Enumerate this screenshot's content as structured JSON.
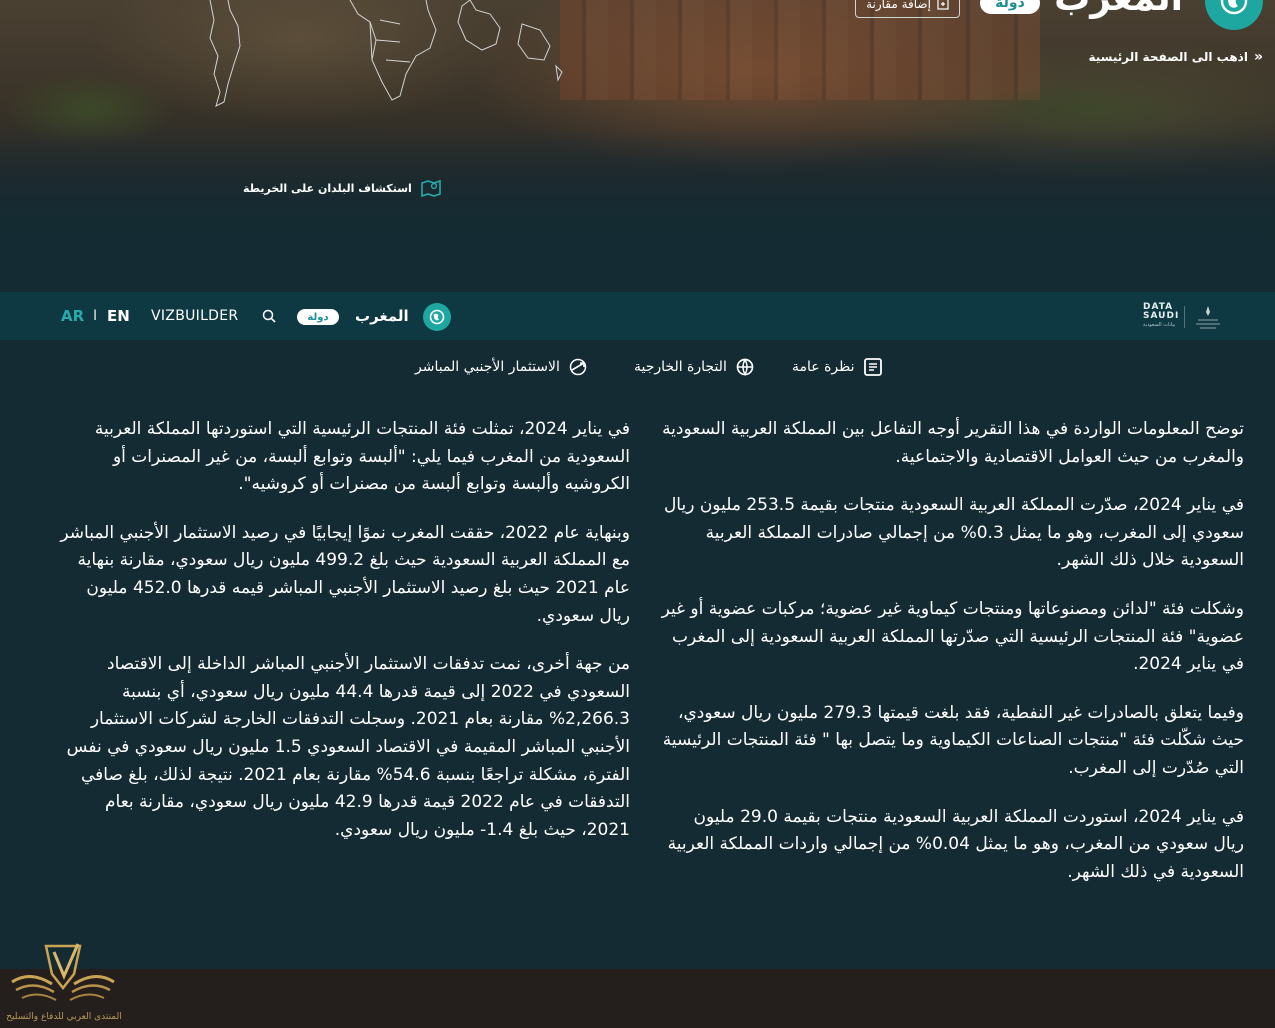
{
  "hero": {
    "country_title": "المغرب",
    "type_badge": "دولة",
    "add_compare_label": "إضافة مقارنة",
    "go_home_label": "اذهب الى الصفحة الرئيسية",
    "explore_map_label": "استكشاف البلدان على الخريطة"
  },
  "navbar": {
    "country_name": "المغرب",
    "type_badge": "دولة",
    "vizbuilder_label": "VIZBUILDER",
    "lang_en": "EN",
    "lang_separator": "I",
    "lang_ar": "AR",
    "logo_main": "DATA SAUDI",
    "logo_sub": "بيانات السعودية"
  },
  "tabs": [
    {
      "label": "نظرة عامة",
      "icon": "document-icon"
    },
    {
      "label": "التجارة الخارجية",
      "icon": "trade-globe-icon"
    },
    {
      "label": "الاستثمار الأجنبي المباشر",
      "icon": "investment-icon"
    }
  ],
  "content": {
    "right_column": [
      "توضح المعلومات الواردة في هذا التقرير أوجه التفاعل بين المملكة العربية السعودية والمغرب من حيث العوامل الاقتصادية والاجتماعية.",
      "في يناير 2024، صدّرت المملكة العربية السعودية منتجات بقيمة 253.5 مليون ريال سعودي إلى المغرب، وهو ما يمثل 0.3% من إجمالي صادرات المملكة العربية السعودية خلال ذلك الشهر.",
      "وشكلت فئة \"لدائن ومصنوعاتها ومنتجات كيماوية غير عضوية؛ مركبات عضوية أو غير عضوية\" فئة المنتجات الرئيسية التي صدّرتها المملكة العربية السعودية إلى المغرب في يناير 2024.",
      "وفيما يتعلق بالصادرات غير النفطية، فقد بلغت قيمتها 279.3 مليون ريال سعودي، حيث شكّلت فئة \"منتجات الصناعات الكيماوية وما يتصل بها \" فئة المنتجات الرئيسية التي صُدّرت إلى المغرب.",
      "في يناير 2024، استوردت المملكة العربية السعودية منتجات بقيمة 29.0 مليون ريال سعودي من المغرب، وهو ما يمثل 0.04% من إجمالي واردات المملكة العربية السعودية في ذلك الشهر."
    ],
    "left_column": [
      "في يناير 2024، تمثلت فئة المنتجات الرئيسية التي استوردتها المملكة العربية السعودية من المغرب فيما يلي: \"ألبسة وتوابع ألبسة، من غير المصنرات أو الكروشيه وألبسة وتوابع ألبسة من مصنرات أو كروشيه\".",
      "وبنهاية عام 2022، حققت المغرب نموًا إيجابيًا في رصيد الاستثمار الأجنبي المباشر مع المملكة العربية السعودية حيث بلغ 499.2 مليون ريال سعودي، مقارنة بنهاية عام 2021 حيث بلغ رصيد الاستثمار الأجنبي المباشر قيمه قدرها 452.0 مليون ريال سعودي.",
      "من جهة أخرى، نمت تدفقات الاستثمار الأجنبي المباشر الداخلة إلى الاقتصاد السعودي في 2022 إلى قيمة قدرها 44.4 مليون ريال سعودي، أي بنسبة 2,266.3% مقارنة بعام 2021. وسجلت التدفقات الخارجة لشركات الاستثمار الأجنبي المباشر المقيمة في الاقتصاد السعودي 1.5 مليون ريال سعودي في نفس الفترة، مشكلة تراجعًا بنسبة 54.6% مقارنة بعام 2021. نتيجة لذلك، بلغ صافي التدفقات في عام 2022 قيمة قدرها 42.9 مليون ريال سعودي، مقارنة بعام 2021، حيث بلغ 1.4- مليون ريال سعودي."
    ]
  },
  "footer": {
    "watermark_text": "المنتدى العربي للدفاع والتسليح"
  },
  "colors": {
    "background": "#142b33",
    "navbar": "#0e3942",
    "accent": "#1ea7a0",
    "lang_active": "#28a9ac",
    "footer": "#241f1c"
  }
}
